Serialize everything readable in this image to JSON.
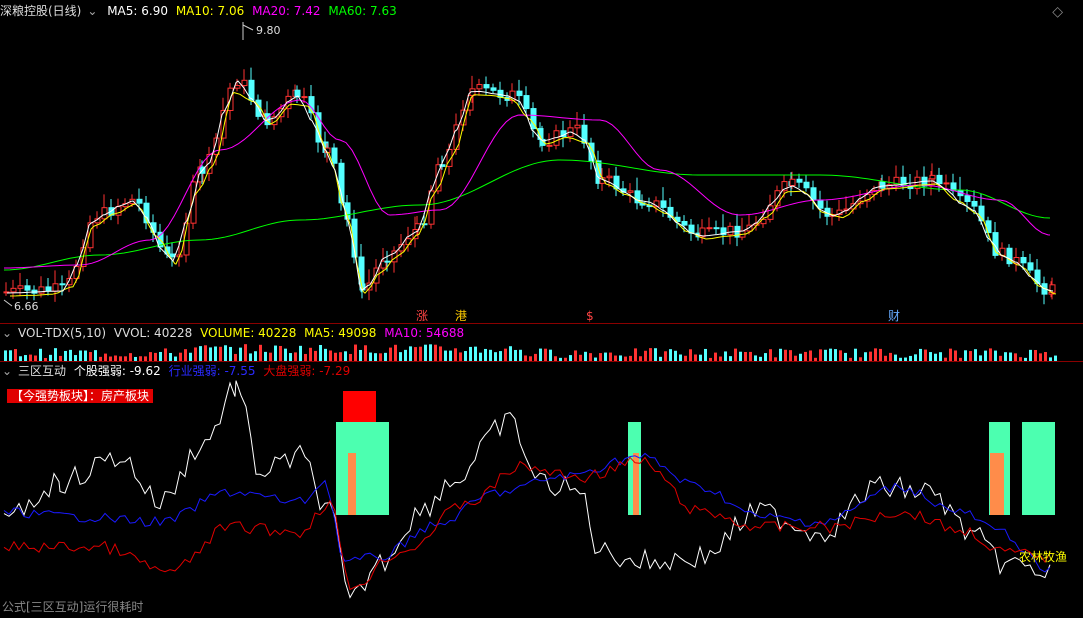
{
  "price_panel": {
    "title": "深粮控股(日线)",
    "ma5": "MA5: 6.90",
    "ma10": "MA10: 7.06",
    "ma20": "MA20: 7.42",
    "ma60": "MA60: 7.63",
    "high_label": "9.80",
    "low_label": "6.66",
    "event_labels": [
      {
        "text": "涨",
        "color": "#ff4444"
      },
      {
        "text": "港",
        "color": "#ffcc00"
      },
      {
        "text": "$",
        "color": "#ff4444"
      },
      {
        "text": "财",
        "color": "#66aaff"
      }
    ]
  },
  "volume_panel": {
    "title": "VOL-TDX(5,10)",
    "vvol": "VVOL: 40228",
    "volume": "VOLUME: 40228",
    "ma5": "MA5: 49098",
    "ma10": "MA10: 54688"
  },
  "indicator_panel": {
    "title": "三区互动",
    "stock": "个股强弱: -9.62",
    "industry": "行业强弱: -7.55",
    "market": "大盘强弱: -7.29",
    "badge": "【今强势板块】：房产板块",
    "sector_label": "农林牧渔",
    "footer": "公式[三区互动]运行很耗时"
  },
  "colors": {
    "up": "#ff3232",
    "down": "#54ffff",
    "ma5": "#ffffff",
    "ma10": "#ffff00",
    "ma20": "#ff00ff",
    "ma60": "#00ff00",
    "stock_line": "#ffffff",
    "industry_line": "#1a1aff",
    "market_line": "#e00000",
    "zone_green": "#4cffb0",
    "zone_orange": "#ff8c4a",
    "zone_red": "#ff0000"
  },
  "icons": {
    "collapse": "chevron-down-icon",
    "settings": "diamond-icon"
  }
}
